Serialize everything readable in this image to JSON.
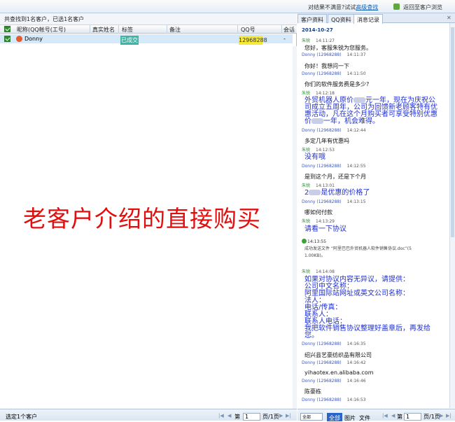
{
  "topbar": {
    "notice_prefix": "对结果不满意?试试",
    "notice_link": "高级查找",
    "back_label": "返回至客户浏览"
  },
  "list": {
    "summary": "共查找到1名客户，已选1名客户",
    "columns": [
      "昵称(QQ帐号(工号)",
      "真实姓名",
      "标签",
      "备注",
      "QQ号",
      "会话"
    ],
    "rows": [
      {
        "nickname": "Donny",
        "realname": "",
        "tag": "已成交",
        "note": "",
        "qq": "12968288",
        "session": "-"
      }
    ],
    "overlay_text": "老客户介绍的直接购买",
    "footer_status": "选定1个客户",
    "page_prefix": "第",
    "page_value": "1",
    "page_total": "页/1页"
  },
  "chat": {
    "tabs": [
      "客户资料",
      "QQ资料",
      "消息记录"
    ],
    "active_tab": "消息记录",
    "date": "2014-10-27",
    "filter_select": "全部",
    "filter_buttons": [
      "全部",
      "图片",
      "文件"
    ],
    "page_prefix": "第",
    "page_value": "1",
    "page_total": "页/1页",
    "messages": {
      "m1_who": "朱锐",
      "m1_time": "14:11:27",
      "m1_text": "您好，客服朱锐为您服务。",
      "m2_who": "Donny (12968288)",
      "m2_time": "14:11:37",
      "m2_text": "你好！我想问一下",
      "m3_who": "Donny (12968288)",
      "m3_time": "14:11:50",
      "m3_text": "你们的软件服务费是多少?",
      "m4_who": "朱锐",
      "m4_time": "14:12:18",
      "m4_l1a": "外贸机器人原价",
      "m4_l1b": "元一年，现在为庆祝公",
      "m4_l2": "司成立五周年，公司为回馈新老顾客特有优",
      "m4_l3": "惠活动，凡在这个月购买者可享受特别优惠",
      "m4_l4a": "价",
      "m4_l4b": "一年，机会难得。",
      "m5_who": "Donny (12968288)",
      "m5_time": "14:12:44",
      "m5_text": "多定几年有优惠吗",
      "m6_who": "朱锐",
      "m6_time": "14:12:53",
      "m6_text": "没有哦",
      "m7_who": "Donny (12968288)",
      "m7_time": "14:12:55",
      "m7_text": "是到这个月，还是下个月",
      "m8_who": "朱锐",
      "m8_time": "14:13:01",
      "m8_text_a": "2",
      "m8_text_b": "是优惠的价格了",
      "m9_who": "Donny (12968288)",
      "m9_time": "14:13:15",
      "m9_text": "哪如何付款",
      "m10_who": "朱锐",
      "m10_time": "14:13:29",
      "m10_text": "请看一下协议",
      "m11_time": "14:13:55",
      "m11_l1": "成功发送文件 “阿里巴巴外贸机器人软件销售协议.doc”(5",
      "m11_l2": "1.00KB)。",
      "m12_who": "朱锐",
      "m12_time": "14:14:08",
      "m12_l1": "如果对协议内容无异议，请提供：",
      "m12_l2": "公司中文名称：",
      "m12_l3": "阿里国际站网址或英文公司名称：",
      "m12_l4": "法人：",
      "m12_l5": "电话/传真：",
      "m12_l6": "联系人：",
      "m12_l7": "联系人电话：",
      "m12_l8": "我把软件销售协议整理好盖章后，再发给",
      "m12_l9": "您。",
      "m13_who": "Donny (12968288)",
      "m13_time": "14:16:35",
      "m13_text": "绍兴县艺豪纺织品有限公司",
      "m14_who": "Donny (12968288)",
      "m14_time": "14:16:42",
      "m14_text": "yihaotex.en.alibaba.com",
      "m15_who": "Donny (12968288)",
      "m15_time": "14:16:46",
      "m15_text": "陈豪栋",
      "m16_who": "Donny (12968288)",
      "m16_time": "14:16:53"
    }
  }
}
